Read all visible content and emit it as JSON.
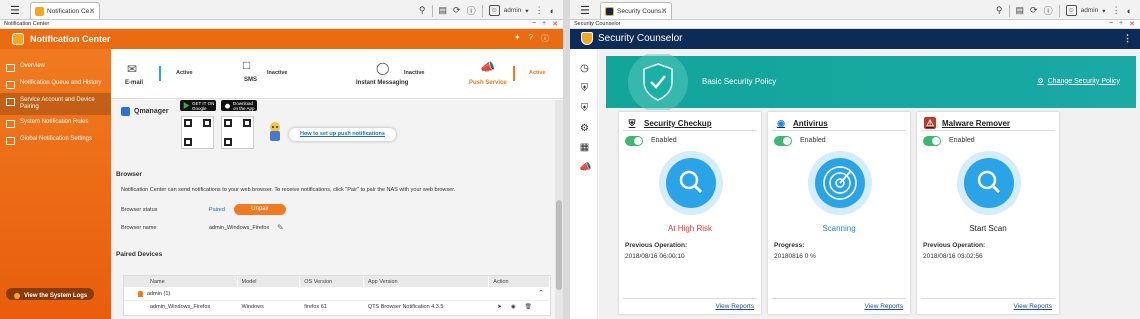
{
  "left": {
    "qts_tab_label": "Notification Ce...",
    "user": "admin",
    "window_title": "Notification Center",
    "app_title": "Notification Center",
    "sidebar": [
      {
        "label": "Overview"
      },
      {
        "label": "Notification Queue and History"
      },
      {
        "label": "Service Account and Device Pairing",
        "active": true
      },
      {
        "label": "System Notification Rules"
      },
      {
        "label": "Global Notification Settings"
      }
    ],
    "logs_button": "View the System Logs",
    "channels": [
      {
        "label": "E-mail",
        "status": "Active"
      },
      {
        "label": "SMS",
        "status": "Inactive"
      },
      {
        "label": "Instant Messaging",
        "status": "Inactive"
      },
      {
        "label": "Push Service",
        "status": "Active"
      }
    ],
    "qmanager": "Qmanager",
    "google_play": "GET IT ON Google play",
    "app_store": "Download on the App Store",
    "howto_link": "How to set up push notifications",
    "browser_title": "Browser",
    "browser_desc": "Notification Center can send notifications to your web browser. To receive notifications, click \"Pair\" to pair the NAS with your web browser.",
    "browser_status_label": "Browser status",
    "browser_status_value": "Paired",
    "unpair_label": "Unpair",
    "browser_name_label": "Browser name",
    "browser_name_value": "admin_Windows_Firefox",
    "paired_title": "Paired Devices",
    "table": {
      "headers": [
        "Name",
        "Model",
        "OS Version",
        "App Version",
        "Action"
      ],
      "group": "admin (1)",
      "row": [
        "admin_Windows_Firefox",
        "Windows",
        "firefox 61",
        "QTS Browser Notification 4.3.5",
        ""
      ]
    }
  },
  "right": {
    "qts_tab_label": "Security Couns...",
    "user": "admin",
    "window_title": "Security Counselor",
    "app_title": "Security Counselor",
    "banner_title": "Basic Security Policy",
    "banner_link": "Change Security Policy",
    "cards": [
      {
        "title": "Security Checkup",
        "toggle": "Enabled",
        "status": "At High Risk",
        "status_color": "#e53935",
        "label": "Previous Operation:",
        "value": "2018/08/16 06:00:10",
        "link": "View Reports"
      },
      {
        "title": "Antivirus",
        "toggle": "Enabled",
        "status": "Scanning",
        "status_color": "#1e88e5",
        "label": "Progress:",
        "value": "20180816 0 %",
        "link": "View Reports"
      },
      {
        "title": "Malware Remover",
        "toggle": "Enabled",
        "status": "Start Scan",
        "status_color": "#222222",
        "label": "Previous Operation:",
        "value": "2018/08/16 03:02:56",
        "link": "View Reports"
      }
    ]
  }
}
